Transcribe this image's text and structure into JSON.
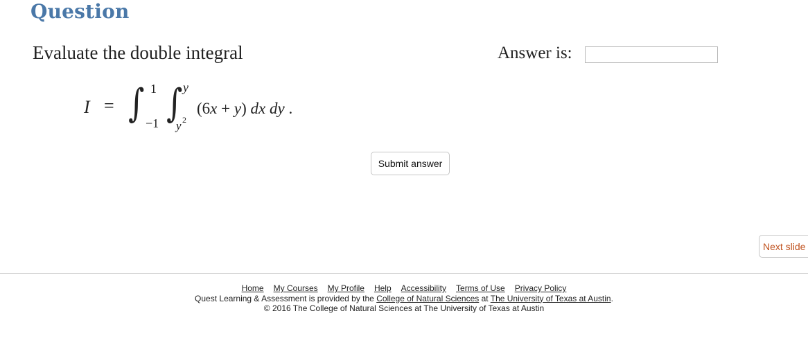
{
  "heading": "Question",
  "prompt": "Evaluate the double integral",
  "integral": {
    "lhs": "I",
    "equals": "=",
    "outer_lower": "−1",
    "outer_upper": "1",
    "inner_lower_base": "y",
    "inner_lower_exp": "2",
    "inner_upper": "y",
    "integrand": "(6x + y) dx dy .",
    "integrand_parts": {
      "open": "(6",
      "x": "x",
      "plus": " + ",
      "y": "y",
      "close": ")",
      "dx_d": "d",
      "dx_x": "x",
      "dy_d": "d",
      "dy_y": "y",
      "period": "."
    }
  },
  "answer": {
    "label": "Answer is:",
    "value": "",
    "placeholder": ""
  },
  "buttons": {
    "submit": "Submit answer",
    "next": "Next slide"
  },
  "footer": {
    "links": [
      "Home",
      "My Courses",
      "My Profile",
      "Help",
      "Accessibility",
      "Terms of Use",
      "Privacy Policy"
    ],
    "provided_prefix": "Quest Learning & Assessment is provided by the ",
    "college_link": "College of Natural Sciences",
    "at_text": " at ",
    "university_link": "The University of Texas at Austin",
    "period": ".",
    "copyright": "© 2016 The College of Natural Sciences at The University of Texas at Austin"
  },
  "colors": {
    "heading": "#4a78a8",
    "next_button_text": "#c0521f"
  }
}
